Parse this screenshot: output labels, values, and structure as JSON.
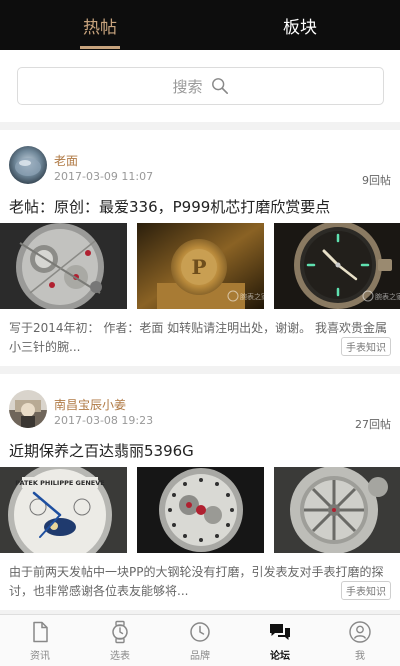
{
  "top_tabs": [
    {
      "label": "热帖",
      "active": true
    },
    {
      "label": "板块",
      "active": false
    }
  ],
  "search": {
    "placeholder": "搜索"
  },
  "posts": [
    {
      "user": "老面",
      "time": "2017-03-09 11:07",
      "replies": "9回帖",
      "title": "老帖：原创：最爱336，P999机芯打磨欣赏要点",
      "excerpt": "写于2014年初：  作者：老面   如转贴请注明出处，谢谢。  我喜欢贵金属小三针的腕...",
      "tag": "手表知识",
      "watermark": "腕表之家"
    },
    {
      "user": "南昌宝辰小姜",
      "time": "2017-03-08 19:23",
      "replies": "27回帖",
      "title": "近期保养之百达翡丽5396G",
      "excerpt": "由于前两天发帖中一块PP的大钢轮没有打磨，引发表友对手表打磨的探讨，也非常感谢各位表友能够将...",
      "tag": "手表知识",
      "dial_text": "PATEK PHILIPPE GENEVE"
    }
  ],
  "bottom_nav": [
    {
      "label": "资讯",
      "icon": "document-icon",
      "active": false
    },
    {
      "label": "选表",
      "icon": "watch-icon",
      "active": false
    },
    {
      "label": "品牌",
      "icon": "clock-icon",
      "active": false
    },
    {
      "label": "论坛",
      "icon": "chat-bubbles-icon",
      "active": true
    },
    {
      "label": "我",
      "icon": "user-icon",
      "active": false
    }
  ],
  "colors": {
    "accent": "#c8a47e",
    "username": "#b07a45",
    "topbar_bg": "#0d0d0d",
    "page_bg": "#f2f2f2"
  }
}
